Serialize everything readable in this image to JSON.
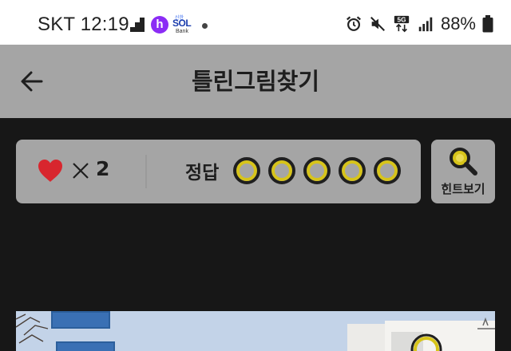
{
  "status_bar": {
    "carrier_time": "SKT 12:19",
    "notification_icons": [
      "stairs-app-icon",
      "h-app-icon",
      "sol-bank-icon",
      "more-dot-icon"
    ],
    "h_icon_letter": "h",
    "sol_top": "신한",
    "sol_mid": "SOL",
    "sol_bottom": "Bank",
    "system_icons": [
      "alarm-icon",
      "mute-icon",
      "5g-icon",
      "signal-icon"
    ],
    "network_label": "5G",
    "battery_text": "88%"
  },
  "header": {
    "title": "틀린그림찾기",
    "back_icon": "arrow-left-icon"
  },
  "game_status": {
    "lives_icon": "heart-icon",
    "lives_count": "2",
    "answer_label": "정답",
    "answer_slots": 5,
    "found": 0,
    "colors": {
      "heart": "#d8262e",
      "ring": "#d7c41a",
      "panel": "#a5a5a5"
    }
  },
  "hint": {
    "label": "힌트보기",
    "icon": "magnifier-icon"
  }
}
